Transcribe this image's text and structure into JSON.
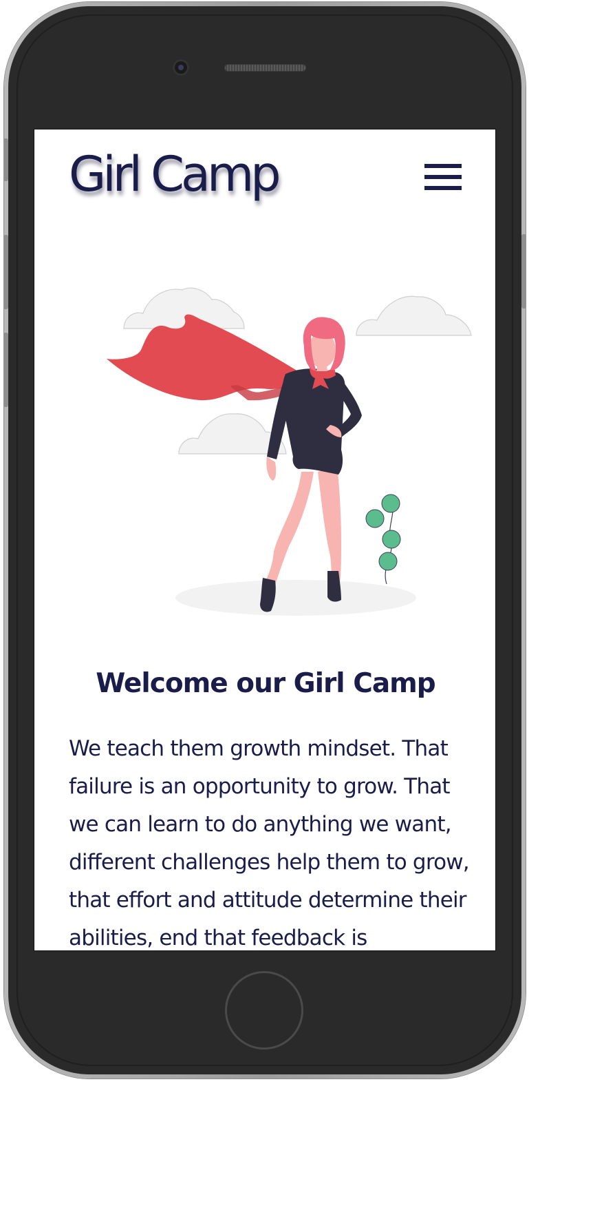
{
  "app": {
    "logo_text": "Girl Camp",
    "menu_icon": "hamburger-menu-icon"
  },
  "hero": {
    "illustration": "superhero-girl-illustration"
  },
  "content": {
    "heading": "Welcome our Girl Camp",
    "paragraph": "We teach them growth mindset. That failure is an opportunity to grow. That we can learn to do anything we want, different challenges help them to grow, that effort and attitude determine their abilities, end that feedback is"
  },
  "colors": {
    "brand_navy": "#1a1c4a",
    "cape_red": "#e24b51",
    "hair_pink": "#f06a82",
    "skin": "#f8b4b1",
    "outfit": "#2f2e41",
    "plant_green": "#5bbd8d",
    "cloud": "#f2f2f2"
  }
}
